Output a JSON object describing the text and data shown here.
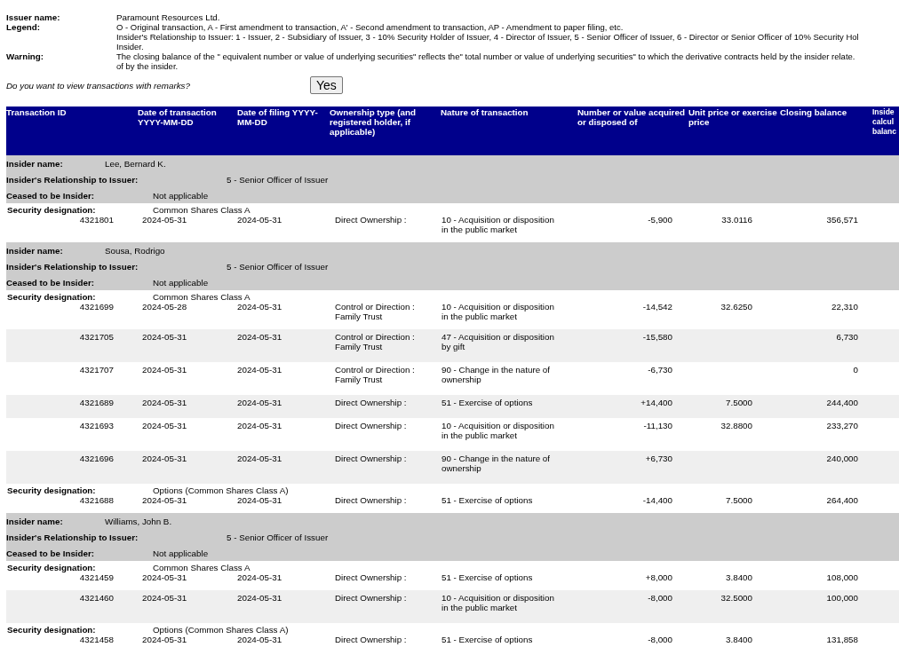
{
  "issuer": {
    "name_label": "Issuer name:",
    "name": "Paramount Resources Ltd.",
    "legend_label": "Legend:",
    "legend_lines": [
      "O - Original transaction, A - First amendment to transaction, A' - Second amendment to transaction, AP - Amendment to paper filing, etc.",
      "Insider's Relationship to Issuer: 1 - Issuer, 2 - Subsidiary of Issuer, 3 - 10% Security Holder of Issuer, 4 - Director of Issuer, 5 - Senior Officer of Issuer, 6 - Director or Senior Officer of 10% Security Hol",
      "Insider."
    ],
    "warning_label": "Warning:",
    "warning_lines": [
      "The closing balance of the \" equivalent number or value of underlying securities\" reflects the\" total number or value of underlying securities\" to which the derivative contracts held by the insider relate.",
      "of by the insider."
    ]
  },
  "remarks": {
    "question": "Do you want to view transactions with remarks?",
    "button": "Yes"
  },
  "table": {
    "columns": [
      "Transaction ID",
      "Date of transaction YYYY-MM-DD",
      "Date of filing YYYY-MM-DD",
      "Ownership type (and registered holder, if applicable)",
      "Nature of transaction",
      "Number or value acquired or disposed of",
      "Unit price or exercise price",
      "Closing balance",
      "Inside calcul balanc"
    ],
    "insiders": [
      {
        "name_label": "Insider name:",
        "name": "Lee, Bernard K.",
        "relationship_label": "Insider's Relationship to Issuer:",
        "relationship": "5 - Senior Officer of Issuer",
        "ceased_label": "Ceased to be Insider:",
        "ceased": "Not applicable",
        "securities": [
          {
            "label": "Security designation:",
            "designation": "Common Shares Class A",
            "transactions": [
              {
                "id": "4321801",
                "date_transaction": "2024-05-31",
                "date_filing": "2024-05-31",
                "ownership": "Direct Ownership :",
                "nature": "10 - Acquisition or disposition in the public market",
                "number": "-5,900",
                "unit_price": "33.0116",
                "closing_balance": "356,571"
              }
            ]
          }
        ]
      },
      {
        "name_label": "Insider name:",
        "name": "Sousa, Rodrigo",
        "relationship_label": "Insider's Relationship to Issuer:",
        "relationship": "5 - Senior Officer of Issuer",
        "ceased_label": "Ceased to be Insider:",
        "ceased": "Not applicable",
        "securities": [
          {
            "label": "Security designation:",
            "designation": "Common Shares Class A",
            "transactions": [
              {
                "id": "4321699",
                "date_transaction": "2024-05-28",
                "date_filing": "2024-05-31",
                "ownership": "Control or Direction : Family Trust",
                "nature": "10 - Acquisition or disposition in the public market",
                "number": "-14,542",
                "unit_price": "32.6250",
                "closing_balance": "22,310"
              },
              {
                "id": "4321705",
                "date_transaction": "2024-05-31",
                "date_filing": "2024-05-31",
                "ownership": "Control or Direction : Family Trust",
                "nature": "47 - Acquisition or disposition by gift",
                "number": "-15,580",
                "closing_balance": "6,730"
              },
              {
                "id": "4321707",
                "date_transaction": "2024-05-31",
                "date_filing": "2024-05-31",
                "ownership": "Control or Direction : Family Trust",
                "nature": "90 - Change in the nature of ownership",
                "number": "-6,730",
                "closing_balance": "0"
              },
              {
                "id": "4321689",
                "date_transaction": "2024-05-31",
                "date_filing": "2024-05-31",
                "ownership": "Direct Ownership :",
                "nature": "51 - Exercise of options",
                "number": "+14,400",
                "unit_price": "7.5000",
                "closing_balance": "244,400"
              },
              {
                "id": "4321693",
                "date_transaction": "2024-05-31",
                "date_filing": "2024-05-31",
                "ownership": "Direct Ownership :",
                "nature": "10 - Acquisition or disposition in the public market",
                "number": "-11,130",
                "unit_price": "32.8800",
                "closing_balance": "233,270"
              },
              {
                "id": "4321696",
                "date_transaction": "2024-05-31",
                "date_filing": "2024-05-31",
                "ownership": "Direct Ownership :",
                "nature": "90 - Change in the nature of ownership",
                "number": "+6,730",
                "closing_balance": "240,000"
              }
            ]
          },
          {
            "label": "Security designation:",
            "designation": "Options (Common Shares Class A)",
            "transactions": [
              {
                "id": "4321688",
                "date_transaction": "2024-05-31",
                "date_filing": "2024-05-31",
                "ownership": "Direct Ownership :",
                "nature": "51 - Exercise of options",
                "number": "-14,400",
                "unit_price": "7.5000",
                "closing_balance": "264,400"
              }
            ]
          }
        ]
      },
      {
        "name_label": "Insider name:",
        "name": "Williams, John B.",
        "relationship_label": "Insider's Relationship to Issuer:",
        "relationship": "5 - Senior Officer of Issuer",
        "ceased_label": "Ceased to be Insider:",
        "ceased": "Not applicable",
        "securities": [
          {
            "label": "Security designation:",
            "designation": "Common Shares Class A",
            "transactions": [
              {
                "id": "4321459",
                "date_transaction": "2024-05-31",
                "date_filing": "2024-05-31",
                "ownership": "Direct Ownership :",
                "nature": "51 - Exercise of options",
                "number": "+8,000",
                "unit_price": "3.8400",
                "closing_balance": "108,000"
              },
              {
                "id": "4321460",
                "date_transaction": "2024-05-31",
                "date_filing": "2024-05-31",
                "ownership": "Direct Ownership :",
                "nature": "10 - Acquisition or disposition in the public market",
                "number": "-8,000",
                "unit_price": "32.5000",
                "closing_balance": "100,000"
              }
            ]
          },
          {
            "label": "Security designation:",
            "designation": "Options (Common Shares Class A)",
            "transactions": [
              {
                "id": "4321458",
                "date_transaction": "2024-05-31",
                "date_filing": "2024-05-31",
                "ownership": "Direct Ownership :",
                "nature": "51 - Exercise of options",
                "number": "-8,000",
                "unit_price": "3.8400",
                "closing_balance": "131,858"
              }
            ]
          }
        ]
      }
    ]
  }
}
